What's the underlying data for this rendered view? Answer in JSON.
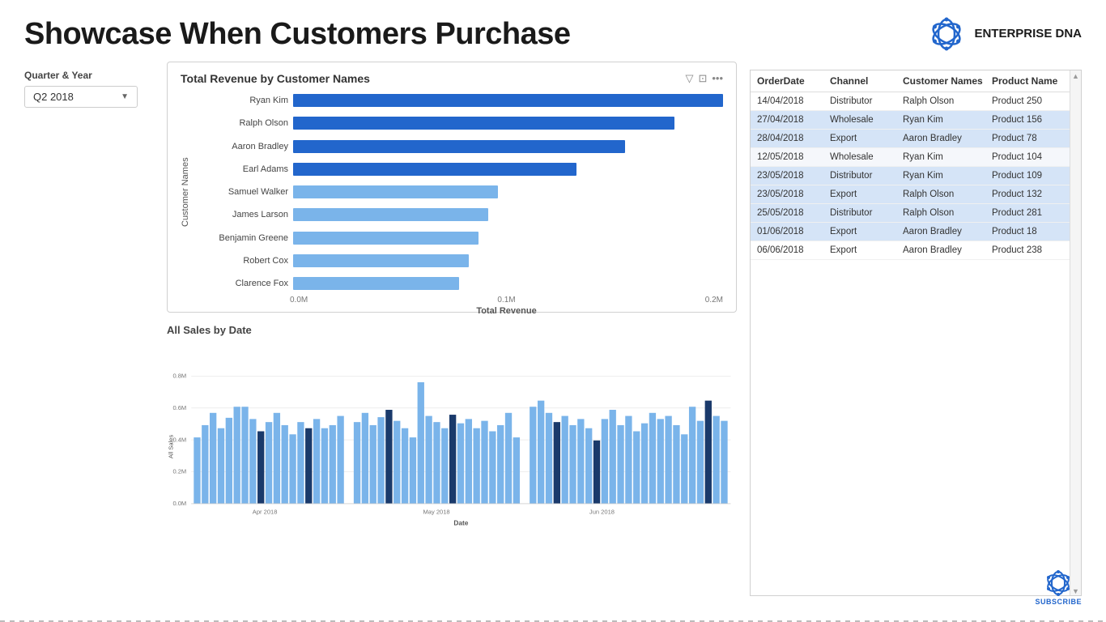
{
  "header": {
    "title": "Showcase When Customers Purchase",
    "logo_text": "ENTERPRISE DNA"
  },
  "filter": {
    "label": "Quarter & Year",
    "value": "Q2 2018"
  },
  "bar_chart": {
    "title": "Total Revenue by Customer Names",
    "y_axis_label": "Customer Names",
    "x_axis_label": "Total Revenue",
    "x_axis_ticks": [
      "0.0M",
      "0.1M",
      "0.2M"
    ],
    "bars": [
      {
        "label": "Ryan Kim",
        "value": 0.88,
        "highlighted": true
      },
      {
        "label": "Ralph Olson",
        "value": 0.78,
        "highlighted": true
      },
      {
        "label": "Aaron Bradley",
        "value": 0.68,
        "highlighted": true
      },
      {
        "label": "Earl Adams",
        "value": 0.58,
        "highlighted": true
      },
      {
        "label": "Samuel Walker",
        "value": 0.42,
        "highlighted": false
      },
      {
        "label": "James Larson",
        "value": 0.4,
        "highlighted": false
      },
      {
        "label": "Benjamin Greene",
        "value": 0.38,
        "highlighted": false
      },
      {
        "label": "Robert Cox",
        "value": 0.36,
        "highlighted": false
      },
      {
        "label": "Clarence Fox",
        "value": 0.34,
        "highlighted": false
      }
    ]
  },
  "bottom_chart": {
    "title": "All Sales by Date",
    "y_axis_label": "All Sales",
    "y_ticks": [
      "0.8M",
      "0.6M",
      "0.4M",
      "0.2M",
      "0.0M"
    ],
    "x_ticks": [
      "Apr 2018",
      "May 2018",
      "Jun 2018"
    ],
    "x_axis_label": "Date"
  },
  "table": {
    "columns": [
      "OrderDate",
      "Channel",
      "Customer Names",
      "Product Name"
    ],
    "rows": [
      {
        "date": "14/04/2018",
        "channel": "Distributor",
        "customer": "Ralph Olson",
        "product": "Product 250",
        "highlighted": false
      },
      {
        "date": "27/04/2018",
        "channel": "Wholesale",
        "customer": "Ryan Kim",
        "product": "Product 156",
        "highlighted": true
      },
      {
        "date": "28/04/2018",
        "channel": "Export",
        "customer": "Aaron Bradley",
        "product": "Product 78",
        "highlighted": true
      },
      {
        "date": "12/05/2018",
        "channel": "Wholesale",
        "customer": "Ryan Kim",
        "product": "Product 104",
        "highlighted": false
      },
      {
        "date": "23/05/2018",
        "channel": "Distributor",
        "customer": "Ryan Kim",
        "product": "Product 109",
        "highlighted": true
      },
      {
        "date": "23/05/2018",
        "channel": "Export",
        "customer": "Ralph Olson",
        "product": "Product 132",
        "highlighted": true
      },
      {
        "date": "25/05/2018",
        "channel": "Distributor",
        "customer": "Ralph Olson",
        "product": "Product 281",
        "highlighted": true
      },
      {
        "date": "01/06/2018",
        "channel": "Export",
        "customer": "Aaron Bradley",
        "product": "Product 18",
        "highlighted": true
      },
      {
        "date": "06/06/2018",
        "channel": "Export",
        "customer": "Aaron Bradley",
        "product": "Product 238",
        "highlighted": false
      }
    ]
  },
  "subscribe": {
    "label": "SUBSCRIBE"
  }
}
